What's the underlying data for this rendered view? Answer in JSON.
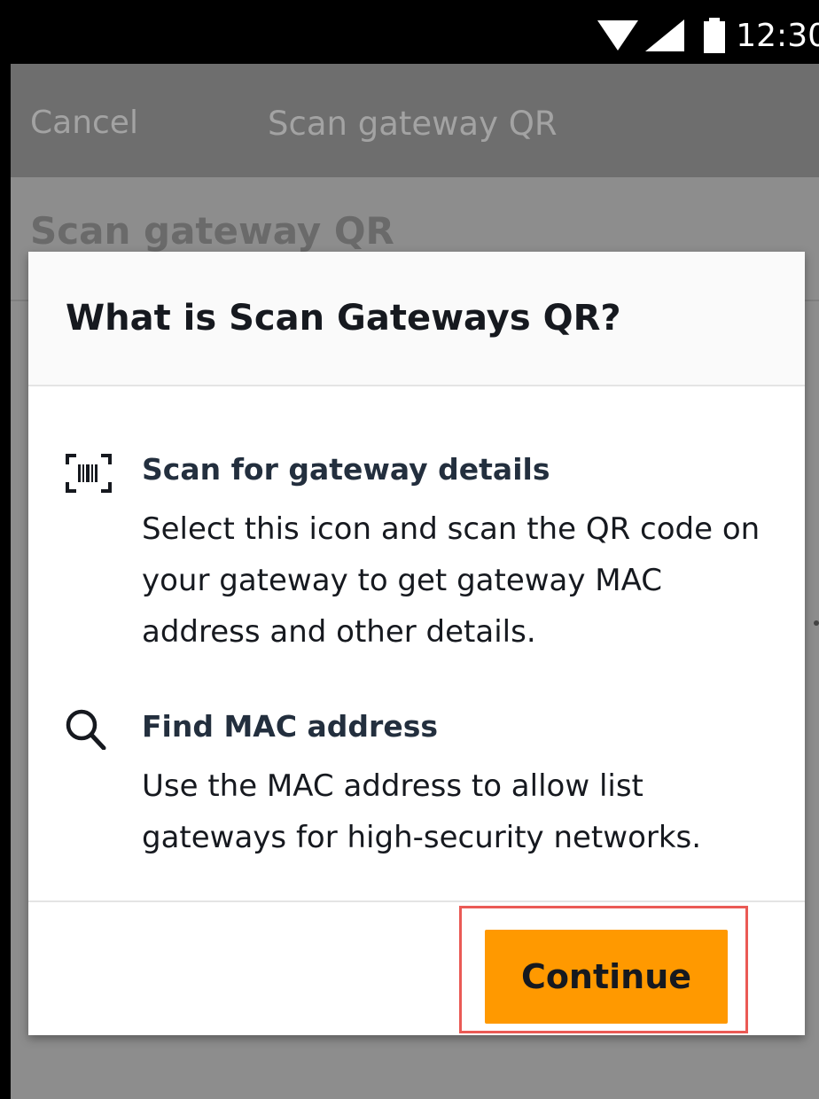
{
  "status_bar": {
    "time": "12:30"
  },
  "app_header": {
    "cancel_label": "Cancel",
    "title": "Scan gateway QR"
  },
  "page": {
    "heading": "Scan gateway QR"
  },
  "dialog": {
    "title": "What is Scan Gateways QR?",
    "items": [
      {
        "icon": "barcode-scan-icon",
        "title": "Scan for gateway details",
        "description": "Select this icon and scan the QR code on your gateway to get gateway MAC address and other details."
      },
      {
        "icon": "search-icon",
        "title": "Find MAC address",
        "description": "Use the MAC address to allow list gateways for high-security networks."
      }
    ],
    "continue_label": "Continue"
  },
  "colors": {
    "primary_button": "#ff9900",
    "highlight_border": "#ea5a55",
    "heading_text": "#16191f"
  }
}
